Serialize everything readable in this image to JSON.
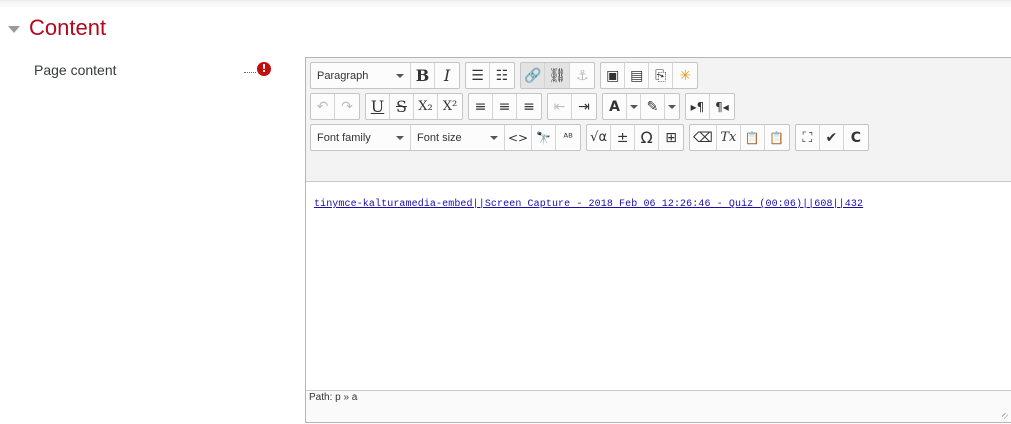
{
  "section": {
    "title": "Content",
    "icon": "caret-down-icon"
  },
  "field": {
    "label": "Page content",
    "required_icon": "exclamation-required-icon",
    "required_glyph": "!"
  },
  "toolbar": {
    "row1": {
      "format_select": "Paragraph",
      "bold": "B",
      "italic": "I",
      "bullet_list": "☰",
      "numbered_list": "☷",
      "link": "🔗",
      "unlink": "⛓",
      "anchor": "⚓",
      "image": "▣",
      "media": "▤",
      "manage_files": "⎘",
      "emoji": "✳"
    },
    "row2": {
      "undo": "↶",
      "redo": "↷",
      "underline": "U",
      "strikethrough": "S",
      "subscript": "X₂",
      "superscript": "X²",
      "align_left": "≡",
      "align_center": "≡",
      "align_right": "≡",
      "outdent": "⇤",
      "indent": "⇥",
      "font_color": "A",
      "background_color": "✎",
      "ltr": "▸¶",
      "rtl": "¶◂"
    },
    "row3": {
      "font_family": "Font family",
      "font_size": "Font size",
      "source_code": "<>",
      "find_replace": "🔭",
      "spellcheck": "ᴬᴮ",
      "equation": "√α",
      "special_char_plus": "±",
      "special_char": "Ω",
      "table": "⊞",
      "clear_format": "⌫",
      "remove_format": "Tx",
      "paste_text": "📋",
      "paste_word": "📋",
      "fullscreen": "⛶",
      "accessibility": "✔",
      "more": "C"
    }
  },
  "content": {
    "embed_link": "tinymce-kalturamedia-embed||Screen Capture - 2018 Feb 06 12:26:46 - Quiz (00:06)||608||432"
  },
  "status": {
    "path": "Path: p » a"
  }
}
